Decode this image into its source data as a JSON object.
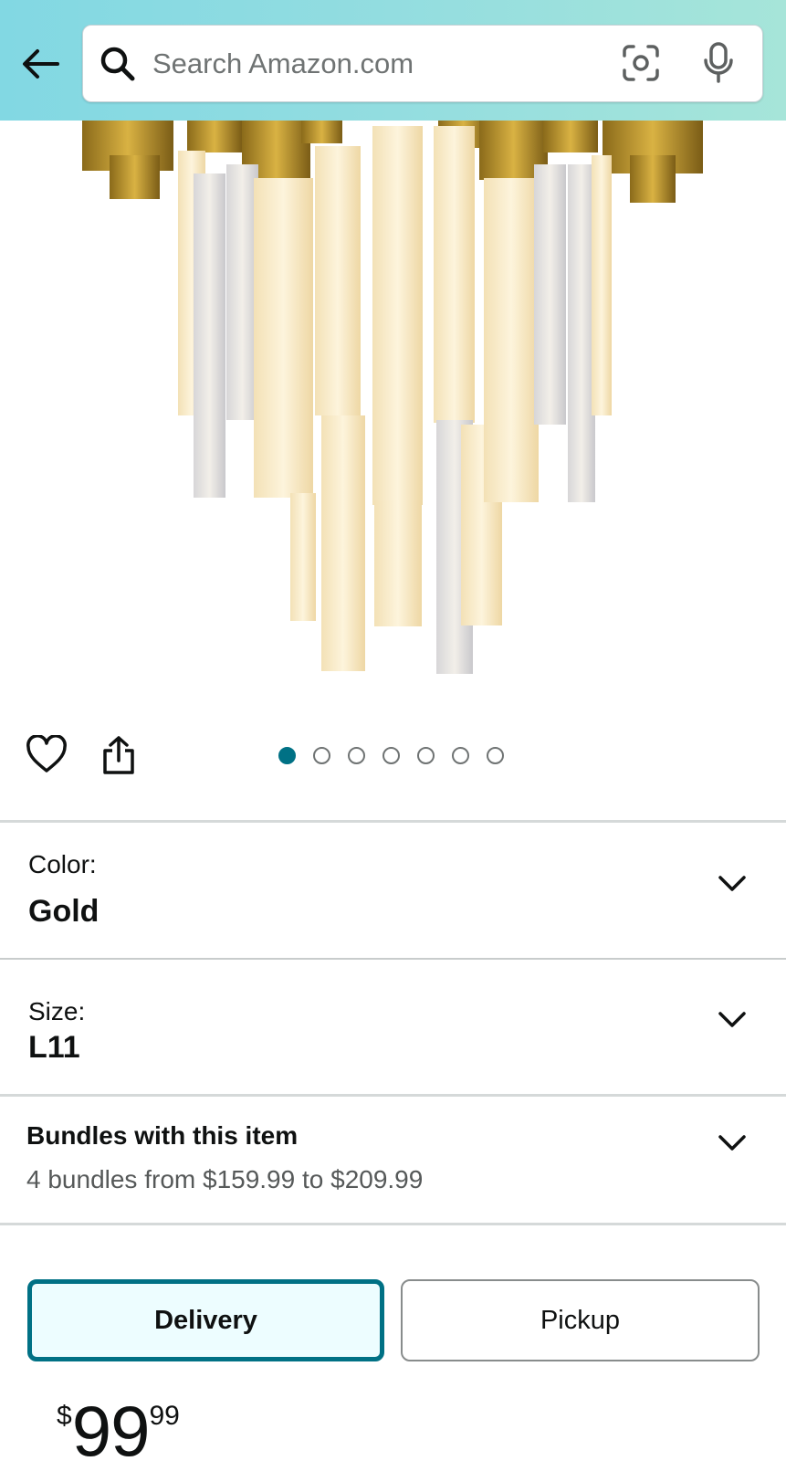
{
  "header": {
    "search_placeholder": "Search Amazon.com"
  },
  "icons": {
    "back": "arrow-left-icon",
    "search": "search-icon",
    "camera": "camera-scan-icon",
    "mic": "microphone-icon",
    "heart": "heart-icon",
    "share": "share-icon",
    "chevron": "chevron-down-icon"
  },
  "gallery": {
    "image_count": 7,
    "active_index": 0
  },
  "variations": [
    {
      "label": "Color:",
      "value": "Gold"
    },
    {
      "label": "Size:",
      "value": "L11"
    }
  ],
  "bundles": {
    "title": "Bundles with this item",
    "subtitle": "4 bundles from $159.99 to $209.99"
  },
  "fulfillment": {
    "delivery_label": "Delivery",
    "pickup_label": "Pickup",
    "selected": "Delivery"
  },
  "price": {
    "symbol": "$",
    "whole": "99",
    "fraction": "99"
  },
  "colors": {
    "header_gradient_start": "#82d8e3",
    "header_gradient_end": "#a6e5d9",
    "accent_teal": "#007185",
    "selected_bg": "#edfdff",
    "gold": "#d4a72c"
  }
}
